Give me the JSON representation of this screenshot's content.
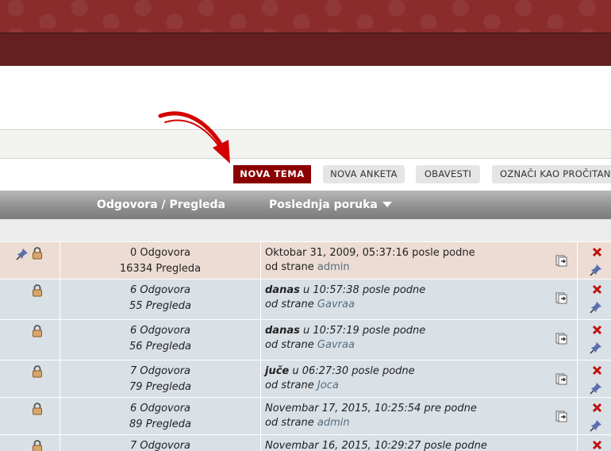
{
  "buttons": {
    "new_topic": "NOVA TEMA",
    "new_poll": "NOVA ANKETA",
    "notify": "OBAVESTI",
    "mark_read": "OZNAČI KAO PROČITANO"
  },
  "table": {
    "headers": {
      "replies_views": "Odgovora / Pregleda",
      "last_post": "Poslednja poruka"
    },
    "rows": [
      {
        "replies": "0 Odgovora",
        "views": "16334 Pregleda",
        "date_bold": "",
        "date": "Oktobar 31, 2009, 05:37:16 posle podne",
        "by": "od strane",
        "author": "admin"
      },
      {
        "replies": "6 Odgovora",
        "views": "55 Pregleda",
        "date_bold": "danas",
        "date": " u 10:57:38 posle podne",
        "by": "od strane",
        "author": "Gavraa"
      },
      {
        "replies": "6 Odgovora",
        "views": "56 Pregleda",
        "date_bold": "danas",
        "date": " u 10:57:19 posle podne",
        "by": "od strane",
        "author": "Gavraa"
      },
      {
        "replies": "7 Odgovora",
        "views": "79 Pregleda",
        "date_bold": "juče",
        "date": " u 06:27:30 posle podne",
        "by": "od strane",
        "author": "Joca"
      },
      {
        "replies": "6 Odgovora",
        "views": "89 Pregleda",
        "date_bold": "",
        "date": "Novembar 17, 2015, 10:25:54 pre podne",
        "by": "od strane",
        "author": "admin"
      },
      {
        "replies": "7 Odgovora",
        "views": "",
        "date_bold": "",
        "date": "Novembar 16, 2015, 10:29:27 posle podne",
        "by": "",
        "author": ""
      }
    ]
  },
  "icons": {
    "pin": "pin-icon",
    "lock": "lock-icon",
    "goto": "go-to-last-post-icon",
    "delete": "delete-x-icon"
  },
  "colors": {
    "header_top": "#8a2c2c",
    "header_bottom": "#642020",
    "primary_button": "#8b0000",
    "sticky_row": "#ecdcd4",
    "normal_row": "#d9e0e6",
    "arrow": "#d40000"
  }
}
